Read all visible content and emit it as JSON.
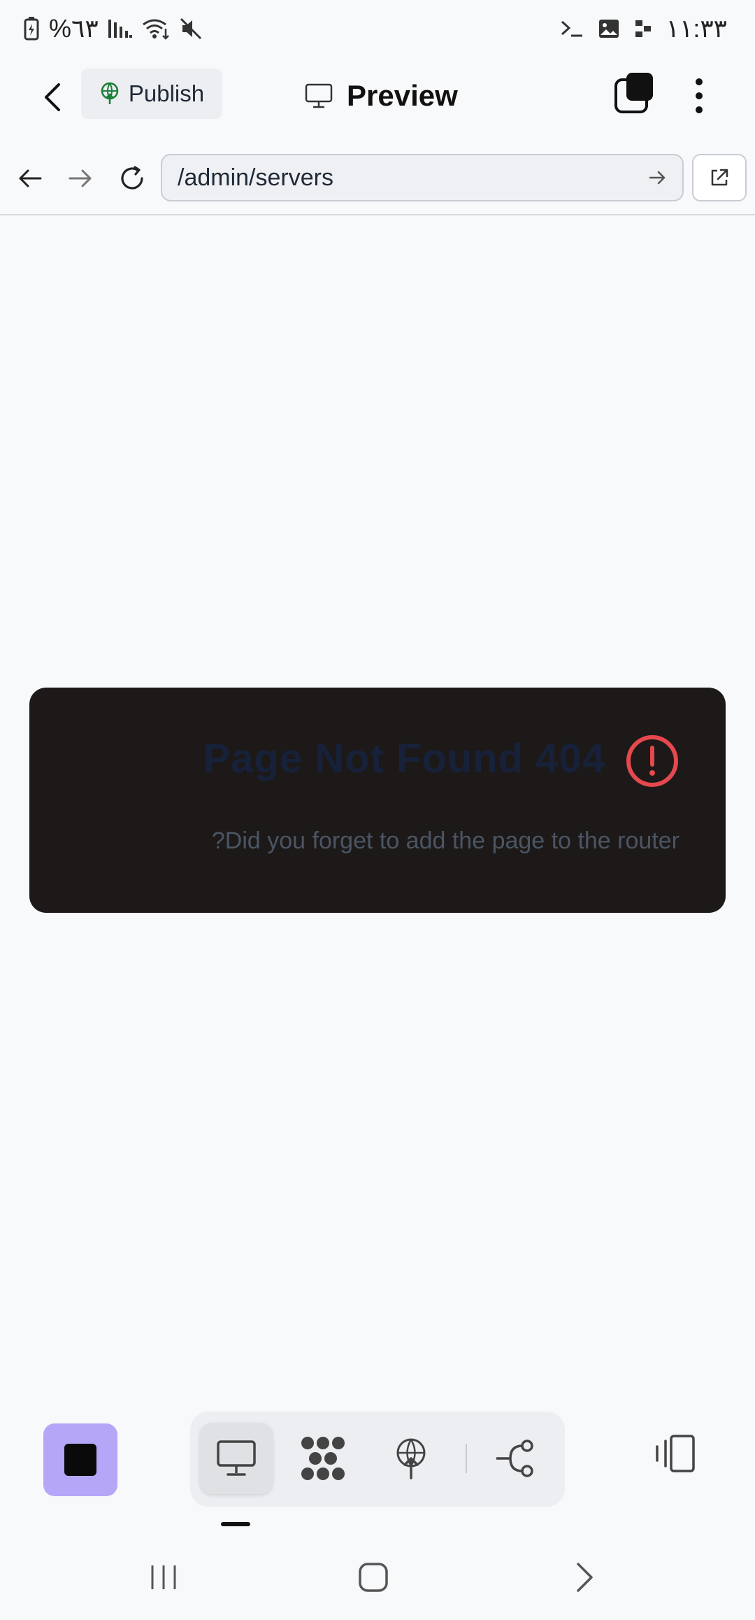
{
  "status_bar": {
    "battery": "%٦٣",
    "time": "١١:٣٣"
  },
  "header": {
    "publish_label": "Publish",
    "title": "Preview"
  },
  "browser": {
    "url": "/admin/servers"
  },
  "content": {
    "error_title": "Page Not Found 404",
    "error_subtitle": "?Did you forget to add the page to the router"
  },
  "colors": {
    "stop_button_bg": "#b6a6f7",
    "card_bg": "#1c1918",
    "alert_red": "#e5484d",
    "publish_icon_green": "#1a7f37"
  },
  "toolbar": {
    "tabs": [
      "desktop-preview",
      "grid-dots",
      "publish-globe",
      "workflow"
    ],
    "active_tab": "desktop-preview"
  }
}
